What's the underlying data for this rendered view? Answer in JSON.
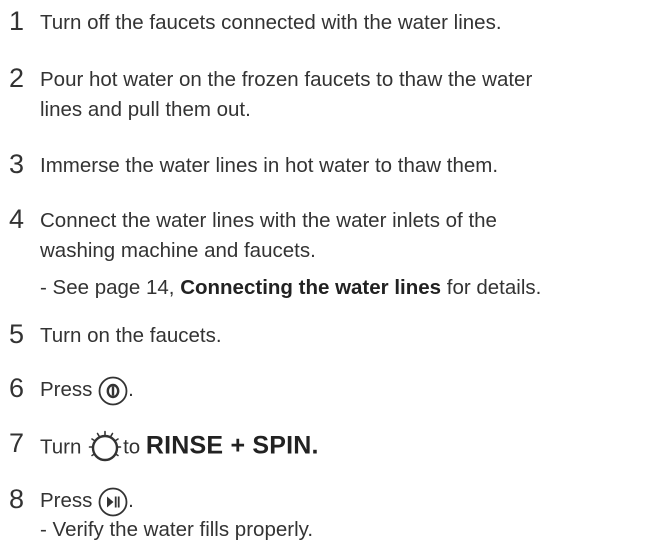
{
  "steps": [
    {
      "number": "1",
      "lines": [
        "Turn off the faucets connected with the water lines."
      ]
    },
    {
      "number": "2",
      "lines": [
        "Pour hot water on the frozen faucets to thaw the water",
        "lines and pull them out."
      ]
    },
    {
      "number": "3",
      "lines": [
        "Immerse the water lines in hot water to thaw them."
      ]
    },
    {
      "number": "4",
      "lines": [
        "Connect the water lines with the water inlets of the",
        "washing machine and faucets."
      ],
      "note_prefix": "- See page 14, ",
      "note_bold": "Connecting the water lines",
      "note_suffix": " for details."
    },
    {
      "number": "5",
      "lines": [
        "Turn on the faucets."
      ]
    },
    {
      "number": "6",
      "before_icon": "Press ",
      "icon": "power-button-icon",
      "after_icon": "."
    },
    {
      "number": "7",
      "before_icon": "Turn ",
      "icon": "program-dial-icon",
      "mid_text": "to ",
      "bold_text": "RINSE + SPIN."
    },
    {
      "number": "8",
      "before_icon": "Press ",
      "icon": "start-pause-button-icon",
      "after_icon": ".",
      "note": "- Verify the water fills properly."
    }
  ]
}
